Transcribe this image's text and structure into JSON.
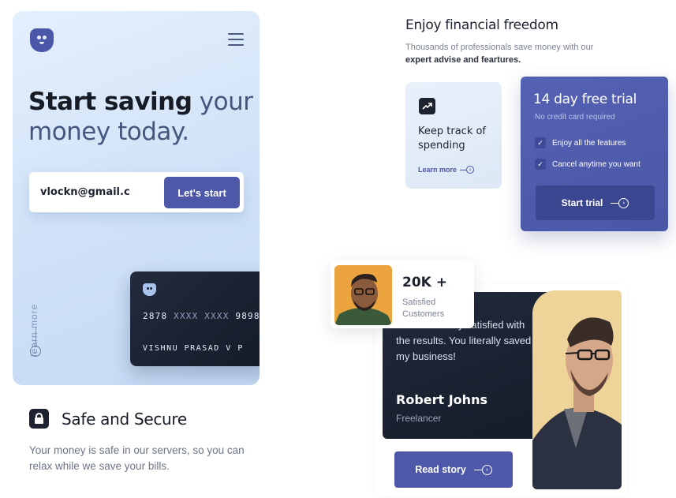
{
  "phone": {
    "hero_strong": "Start saving",
    "hero_soft_1": " your",
    "hero_soft_2": "money today.",
    "email_value": "vlockn@gmail.c",
    "start_button": "Let's start",
    "learn_more": "learn more",
    "card": {
      "number_first": "2878",
      "number_mask_1": "XXXX",
      "number_mask_2": "XXXX",
      "number_last": "9898",
      "holder": "VISHNU  PRASAD  V  P"
    },
    "colors": {
      "accent": "#4d58a9",
      "dark": "#1c2230",
      "panel": "#cfe1f7"
    }
  },
  "safe": {
    "title": "Safe and Secure",
    "description": "Your money is safe in our servers, so you can relax while we save your bills.",
    "icon": "lock-icon"
  },
  "finance": {
    "title": "Enjoy financial freedom",
    "subtitle_plain": "Thousands of professionals save money with our",
    "subtitle_bold": "expert advise and feartures.",
    "track_card": {
      "icon": "trend-up-icon",
      "title": "Keep track of spending",
      "link": "Learn more"
    }
  },
  "trial": {
    "title": "14 day free trial",
    "subtitle": "No credit card required",
    "features": [
      "Enjoy all the features",
      "Cancel anytime you want"
    ],
    "button": "Start trial"
  },
  "testimonial": {
    "count": "20K +",
    "count_label": "Satisfied Customers",
    "quote": "I am extremely satisfied with the results. You literally saved my business!",
    "author": "Robert Johns",
    "role": "Freelancer",
    "button": "Read story"
  }
}
